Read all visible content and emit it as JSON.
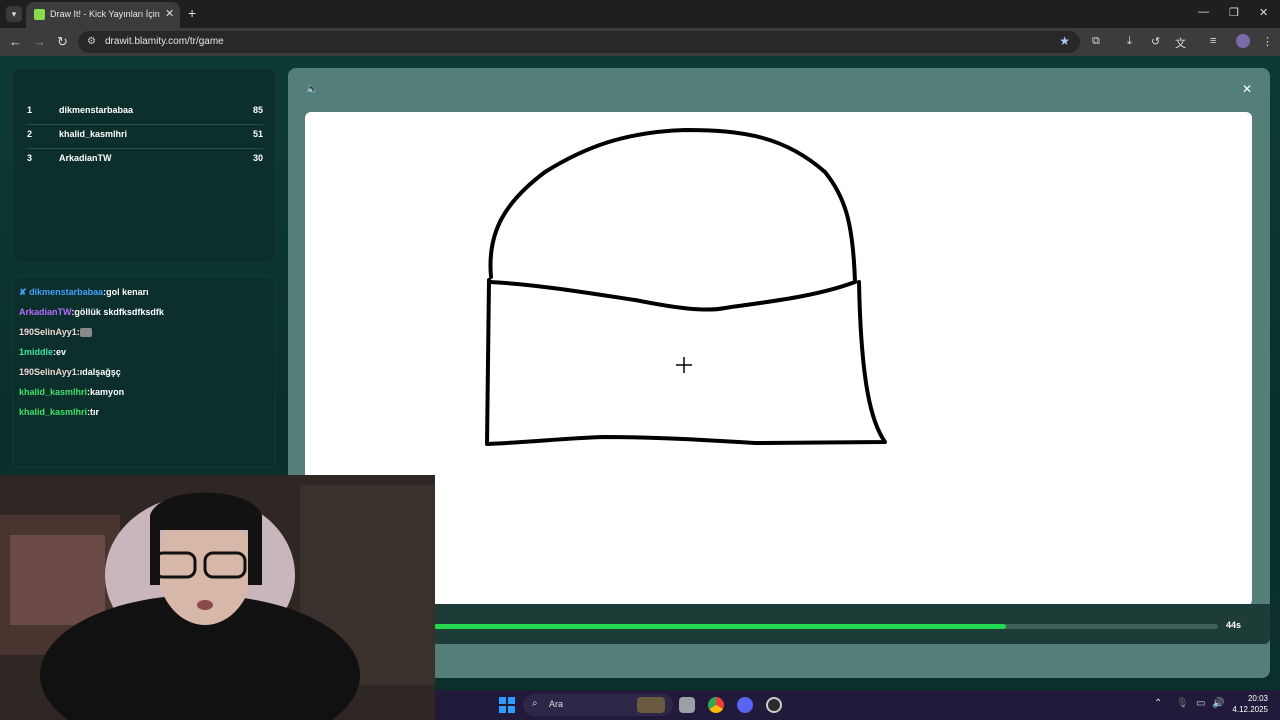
{
  "browser": {
    "tab_title": "Draw It! - Kick Yayınları İçin Çizi",
    "url": "drawit.blamity.com/tr/game",
    "icons": {
      "tab_menu": "chevron-down-icon",
      "new_tab": "plus-icon",
      "back": "arrow-left-icon",
      "forward": "arrow-right-icon",
      "reload": "reload-icon",
      "bookmark": "star-icon"
    }
  },
  "leaderboard": [
    {
      "rank": "1",
      "name": "dikmenstarbabaa",
      "score": "85"
    },
    {
      "rank": "2",
      "name": "khalid_kasmlhri",
      "score": "51"
    },
    {
      "rank": "3",
      "name": "ArkadianTW",
      "score": "30"
    }
  ],
  "chat": [
    {
      "user": "dikmenstarbabaa",
      "msg": "gol kenarı",
      "color": "#3fa0ff",
      "partial": true
    },
    {
      "user": "ArkadianTW",
      "msg": "göllük skdfksdfksdfk",
      "color": "#b06cff"
    },
    {
      "user": "190SelinAyy1",
      "msg": "",
      "color": "#f0d8d8",
      "emote": true
    },
    {
      "user": "1middle",
      "msg": "ev",
      "color": "#3fe0a8"
    },
    {
      "user": "190SelinAyy1",
      "msg": "ıdalşağşç",
      "color": "#f0d8d8"
    },
    {
      "user": "khalid_kasmlhri",
      "msg": "kamyon",
      "color": "#3fe06a"
    },
    {
      "user": "khalid_kasmlhri",
      "msg": "tır",
      "color": "#3fe06a"
    }
  ],
  "game": {
    "timer_text": "44s",
    "timer_fraction": 0.73,
    "accent": "#22d84e"
  },
  "taskbar": {
    "search_label": "Ara",
    "time": "20:03",
    "date": "4.12.2025"
  }
}
